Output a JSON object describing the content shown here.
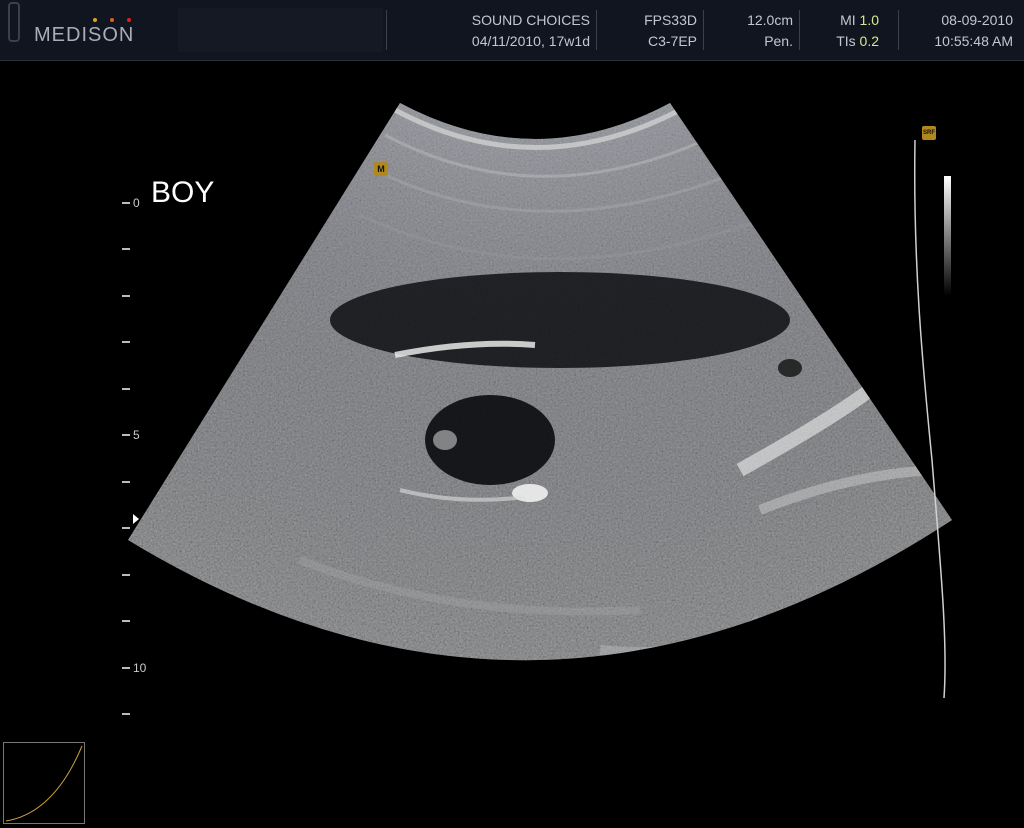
{
  "header": {
    "logo": "MEDISON",
    "institution": "SOUND CHOICES",
    "exam_info": "04/11/2010, 17w1d",
    "frame_rate": "FPS33D",
    "probe": "C3-7EP",
    "depth": "12.0cm",
    "preset": "Pen.",
    "mi_label": "MI",
    "mi_value": "1.0",
    "tis_label": "TIs",
    "tis_value": "0.2",
    "date": "08-09-2010",
    "time": "10:55:48 AM"
  },
  "image": {
    "annotation": "BOY",
    "depth_scale": [
      "0",
      "5",
      "10"
    ],
    "orientation_marker": "M",
    "srf_marker": "SRF"
  },
  "colors": {
    "header_bg": "#11151f",
    "accent_value": "#d8e890",
    "logo_dot_1": "#e0a020",
    "logo_dot_2": "#e06020",
    "logo_dot_3": "#e02020"
  }
}
